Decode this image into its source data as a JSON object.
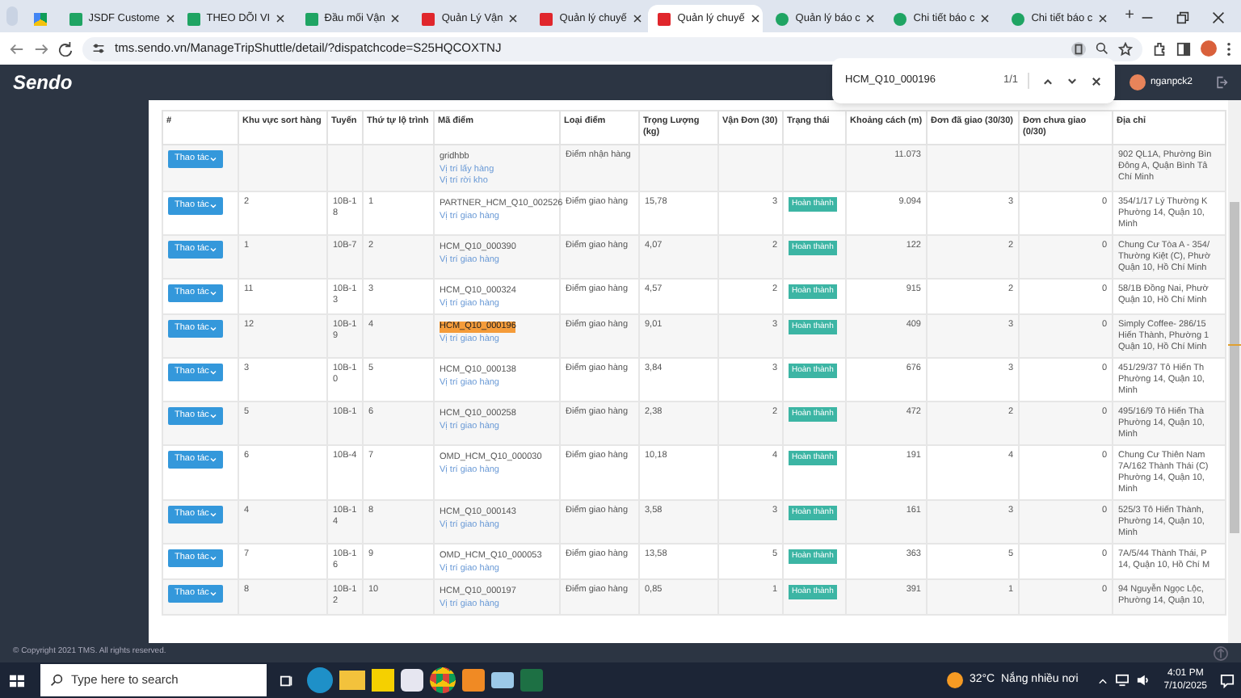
{
  "browser": {
    "tabs": [
      {
        "kind": "drive",
        "selected": false
      },
      {
        "kind": "sheet",
        "title": "JSDF Custome",
        "selected": false
      },
      {
        "kind": "sheet",
        "title": "THEO DÕI VI",
        "selected": false
      },
      {
        "kind": "sheet",
        "title": "Đầu mối Vận",
        "selected": false
      },
      {
        "kind": "sendo",
        "title": "Quản Lý Vận",
        "selected": false
      },
      {
        "kind": "sendo",
        "title": "Quản lý chuyế",
        "selected": false
      },
      {
        "kind": "sendo",
        "title": "Quản lý chuyế",
        "selected": true
      },
      {
        "kind": "report",
        "title": "Quản lý báo c",
        "selected": false
      },
      {
        "kind": "report",
        "title": "Chi tiết báo c",
        "selected": false
      },
      {
        "kind": "report",
        "title": "Chi tiết báo c",
        "selected": false
      }
    ],
    "new_tab": "+",
    "url": "tms.sendo.vn/ManageTripShuttle/detail/?dispatchcode=S25HQCOXTNJ"
  },
  "find_bar": {
    "query": "HCM_Q10_000196",
    "count": "1/1"
  },
  "app": {
    "logo": "Sendo",
    "user": "nganpck2"
  },
  "table": {
    "columns": [
      "#",
      "Khu vực sort hàng",
      "Tuyến",
      "Thứ tự lộ trình",
      "Mã điểm",
      "Loại điểm",
      "Trọng Lượng (kg)",
      "Vận Đơn (30)",
      "Trạng thái",
      "Khoảng cách (m)",
      "Đơn đã giao (30/30)",
      "Đơn chưa giao (0/30)",
      "Địa chỉ"
    ],
    "rows": [
      {
        "area": "",
        "route": "",
        "order": "",
        "action": "Thao tác",
        "code": "gridhbb",
        "find_match": false,
        "links": [
          "Vị trí lấy hàng",
          "Vị trí rời kho"
        ],
        "type": "Điểm nhận hàng",
        "weight": "",
        "waybills": "",
        "status": "",
        "distance": "11.073",
        "delivered": "",
        "pending": "",
        "address": [
          "902 QL1A, Phường Bìn",
          "Đông A, Quận Bình Tâ",
          "Chí Minh"
        ]
      },
      {
        "area": "2",
        "route": "10B-18",
        "order": "1",
        "action": "Thao tác",
        "code": "PARTNER_HCM_Q10_002526",
        "find_match": false,
        "links": [
          "Vị trí giao hàng"
        ],
        "type": "Điểm giao hàng",
        "weight": "15,78",
        "waybills": "3",
        "status": "Hoàn thành",
        "distance": "9.094",
        "delivered": "3",
        "pending": "0",
        "address": [
          "354/1/17 Lý Thường K",
          "Phường 14, Quận 10,",
          "Minh"
        ]
      },
      {
        "area": "1",
        "route": "10B-7",
        "order": "2",
        "action": "Thao tác",
        "code": "HCM_Q10_000390",
        "find_match": false,
        "links": [
          "Vị trí giao hàng"
        ],
        "type": "Điểm giao hàng",
        "weight": "4,07",
        "waybills": "2",
        "status": "Hoàn thành",
        "distance": "122",
        "delivered": "2",
        "pending": "0",
        "address": [
          "Chung Cư Tòa A - 354/",
          "Thường Kiệt (C), Phườ",
          "Quận 10, Hồ Chí Minh"
        ]
      },
      {
        "area": "11",
        "route": "10B-13",
        "order": "3",
        "action": "Thao tác",
        "code": "HCM_Q10_000324",
        "find_match": false,
        "links": [
          "Vị trí giao hàng"
        ],
        "type": "Điểm giao hàng",
        "weight": "4,57",
        "waybills": "2",
        "status": "Hoàn thành",
        "distance": "915",
        "delivered": "2",
        "pending": "0",
        "address": [
          "58/1B Đồng Nai, Phườ",
          "Quận 10, Hồ Chí Minh"
        ]
      },
      {
        "area": "12",
        "route": "10B-19",
        "order": "4",
        "action": "Thao tác",
        "code": "HCM_Q10_000196",
        "find_match": true,
        "links": [
          "Vị trí giao hàng"
        ],
        "type": "Điểm giao hàng",
        "weight": "9,01",
        "waybills": "3",
        "status": "Hoàn thành",
        "distance": "409",
        "delivered": "3",
        "pending": "0",
        "address": [
          "Simply Coffee- 286/15",
          "Hiến Thành, Phường 1",
          "Quận 10, Hồ Chí Minh"
        ]
      },
      {
        "area": "3",
        "route": "10B-10",
        "order": "5",
        "action": "Thao tác",
        "code": "HCM_Q10_000138",
        "find_match": false,
        "links": [
          "Vị trí giao hàng"
        ],
        "type": "Điểm giao hàng",
        "weight": "3,84",
        "waybills": "3",
        "status": "Hoàn thành",
        "distance": "676",
        "delivered": "3",
        "pending": "0",
        "address": [
          "451/29/37 Tô Hiến Th",
          "Phường 14, Quận 10,",
          "Minh"
        ]
      },
      {
        "area": "5",
        "route": "10B-1",
        "order": "6",
        "action": "Thao tác",
        "code": "HCM_Q10_000258",
        "find_match": false,
        "links": [
          "Vị trí giao hàng"
        ],
        "type": "Điểm giao hàng",
        "weight": "2,38",
        "waybills": "2",
        "status": "Hoàn thành",
        "distance": "472",
        "delivered": "2",
        "pending": "0",
        "address": [
          "495/16/9 Tô Hiến Thà",
          "Phường 14, Quận 10,",
          "Minh"
        ]
      },
      {
        "area": "6",
        "route": "10B-4",
        "order": "7",
        "action": "Thao tác",
        "code": "OMD_HCM_Q10_000030",
        "find_match": false,
        "links": [
          "Vị trí giao hàng"
        ],
        "type": "Điểm giao hàng",
        "weight": "10,18",
        "waybills": "4",
        "status": "Hoàn thành",
        "distance": "191",
        "delivered": "4",
        "pending": "0",
        "address": [
          "Chung Cư Thiên Nam",
          "7A/162 Thành Thái (C)",
          "Phường 14, Quận 10,",
          "Minh"
        ]
      },
      {
        "area": "4",
        "route": "10B-14",
        "order": "8",
        "action": "Thao tác",
        "code": "HCM_Q10_000143",
        "find_match": false,
        "links": [
          "Vị trí giao hàng"
        ],
        "type": "Điểm giao hàng",
        "weight": "3,58",
        "waybills": "3",
        "status": "Hoàn thành",
        "distance": "161",
        "delivered": "3",
        "pending": "0",
        "address": [
          "525/3 Tô Hiến Thành,",
          "Phường 14, Quận 10,",
          "Minh"
        ]
      },
      {
        "area": "7",
        "route": "10B-16",
        "order": "9",
        "action": "Thao tác",
        "code": "OMD_HCM_Q10_000053",
        "find_match": false,
        "links": [
          "Vị trí giao hàng"
        ],
        "type": "Điểm giao hàng",
        "weight": "13,58",
        "waybills": "5",
        "status": "Hoàn thành",
        "distance": "363",
        "delivered": "5",
        "pending": "0",
        "address": [
          "7A/5/44 Thành Thái, P",
          "14, Quận 10, Hồ Chí M"
        ]
      },
      {
        "area": "8",
        "route": "10B-12",
        "order": "10",
        "action": "Thao tác",
        "code": "HCM_Q10_000197",
        "find_match": false,
        "links": [
          "Vị trí giao hàng"
        ],
        "type": "Điểm giao hàng",
        "weight": "0,85",
        "waybills": "1",
        "status": "Hoàn thành",
        "distance": "391",
        "delivered": "1",
        "pending": "0",
        "address": [
          "94 Nguyễn Ngọc Lộc,",
          "Phường 14, Quận 10,"
        ]
      }
    ]
  },
  "footer": "© Copyright 2021 TMS. All rights reserved.",
  "taskbar": {
    "search_placeholder": "Type here to search",
    "weather": "32°C  Nắng nhiều nơi",
    "time": "4:01 PM",
    "date": "7/10/2025"
  }
}
